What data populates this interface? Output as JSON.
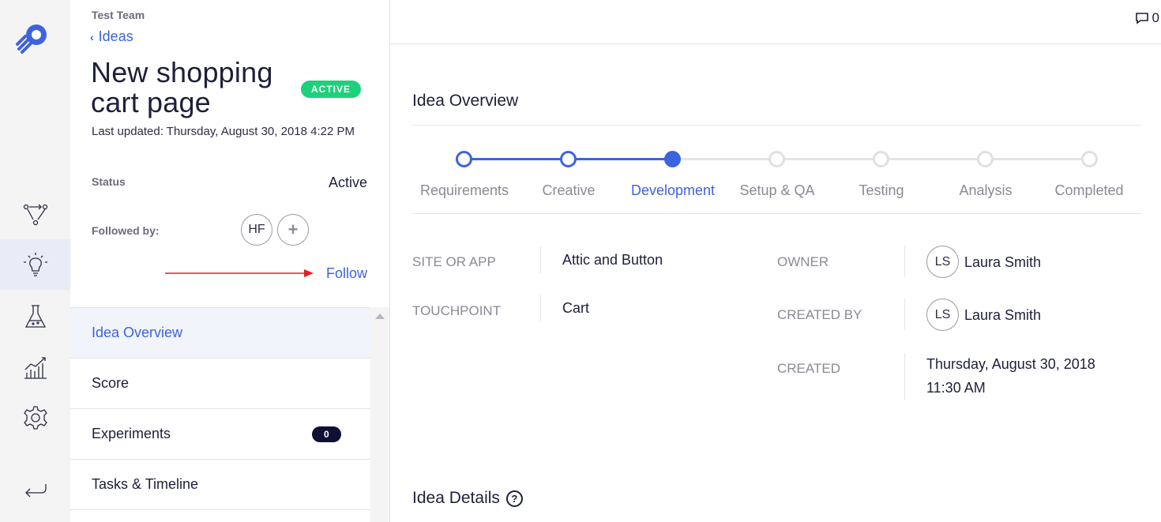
{
  "sidebar_rail": {
    "icons": [
      "logo-icon",
      "workflow-icon",
      "lightbulb-icon",
      "flask-icon",
      "chart-icon",
      "gear-icon",
      "back-arrow-icon"
    ],
    "active": "lightbulb-icon"
  },
  "panel": {
    "team": "Test Team",
    "back_label": "Ideas",
    "title": "New shopping cart page",
    "badge": "ACTIVE",
    "last_updated": "Last updated: Thursday, August 30, 2018 4:22 PM",
    "status_label": "Status",
    "status_value": "Active",
    "followed_label": "Followed by:",
    "follower_initials": "HF",
    "add_follower_icon": "plus-icon",
    "follow_link": "Follow",
    "menu": [
      {
        "label": "Idea Overview",
        "active": true
      },
      {
        "label": "Score",
        "active": false
      },
      {
        "label": "Experiments",
        "active": false,
        "count": "0"
      },
      {
        "label": "Tasks & Timeline",
        "active": false
      }
    ]
  },
  "topbar": {
    "comment_count": "0"
  },
  "overview": {
    "title": "Idea Overview",
    "steps": [
      {
        "label": "Requirements",
        "state": "done"
      },
      {
        "label": "Creative",
        "state": "done"
      },
      {
        "label": "Development",
        "state": "current"
      },
      {
        "label": "Setup & QA",
        "state": "pending"
      },
      {
        "label": "Testing",
        "state": "pending"
      },
      {
        "label": "Analysis",
        "state": "pending"
      },
      {
        "label": "Completed",
        "state": "pending"
      }
    ],
    "fields_left": [
      {
        "label": "SITE OR APP",
        "value": "Attic and Button"
      },
      {
        "label": "TOUCHPOINT",
        "value": "Cart"
      }
    ],
    "fields_right": [
      {
        "label": "OWNER",
        "initials": "LS",
        "value": "Laura Smith"
      },
      {
        "label": "CREATED BY",
        "initials": "LS",
        "value": "Laura Smith"
      },
      {
        "label": "CREATED",
        "value_line1": "Thursday, August 30, 2018",
        "value_line2": "11:30 AM"
      }
    ]
  },
  "details": {
    "title": "Idea Details"
  },
  "colors": {
    "accent": "#3d63dd",
    "active_badge": "#1ed07a",
    "arrow": "#e02020",
    "text": "#1d1f3a",
    "muted": "#8a8a95"
  }
}
